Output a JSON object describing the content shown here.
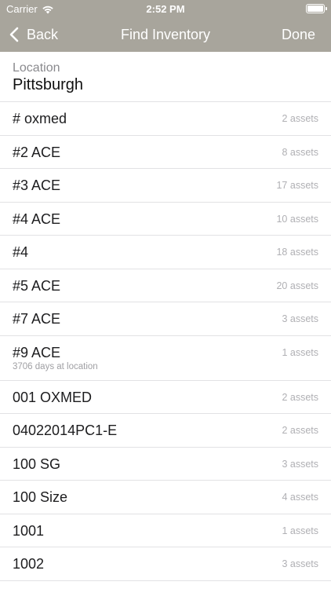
{
  "status_bar": {
    "carrier": "Carrier",
    "time": "2:52 PM"
  },
  "nav": {
    "back_label": "Back",
    "title": "Find Inventory",
    "done_label": "Done"
  },
  "location": {
    "label": "Location",
    "value": "Pittsburgh"
  },
  "items": [
    {
      "name": "# oxmed",
      "count": "2 assets",
      "sub": ""
    },
    {
      "name": "#2 ACE",
      "count": "8 assets",
      "sub": ""
    },
    {
      "name": "#3 ACE",
      "count": "17 assets",
      "sub": ""
    },
    {
      "name": "#4 ACE",
      "count": "10 assets",
      "sub": ""
    },
    {
      "name": "#4",
      "count": "18 assets",
      "sub": ""
    },
    {
      "name": "#5 ACE",
      "count": "20 assets",
      "sub": ""
    },
    {
      "name": "#7 ACE",
      "count": "3 assets",
      "sub": ""
    },
    {
      "name": "#9 ACE",
      "count": "1 assets",
      "sub": "3706 days at location"
    },
    {
      "name": "001 OXMED",
      "count": "2 assets",
      "sub": ""
    },
    {
      "name": "04022014PC1-E",
      "count": "2 assets",
      "sub": ""
    },
    {
      "name": "100 SG",
      "count": "3 assets",
      "sub": ""
    },
    {
      "name": "100 Size",
      "count": "4 assets",
      "sub": ""
    },
    {
      "name": "1001",
      "count": "1 assets",
      "sub": ""
    },
    {
      "name": "1002",
      "count": "3 assets",
      "sub": ""
    }
  ]
}
